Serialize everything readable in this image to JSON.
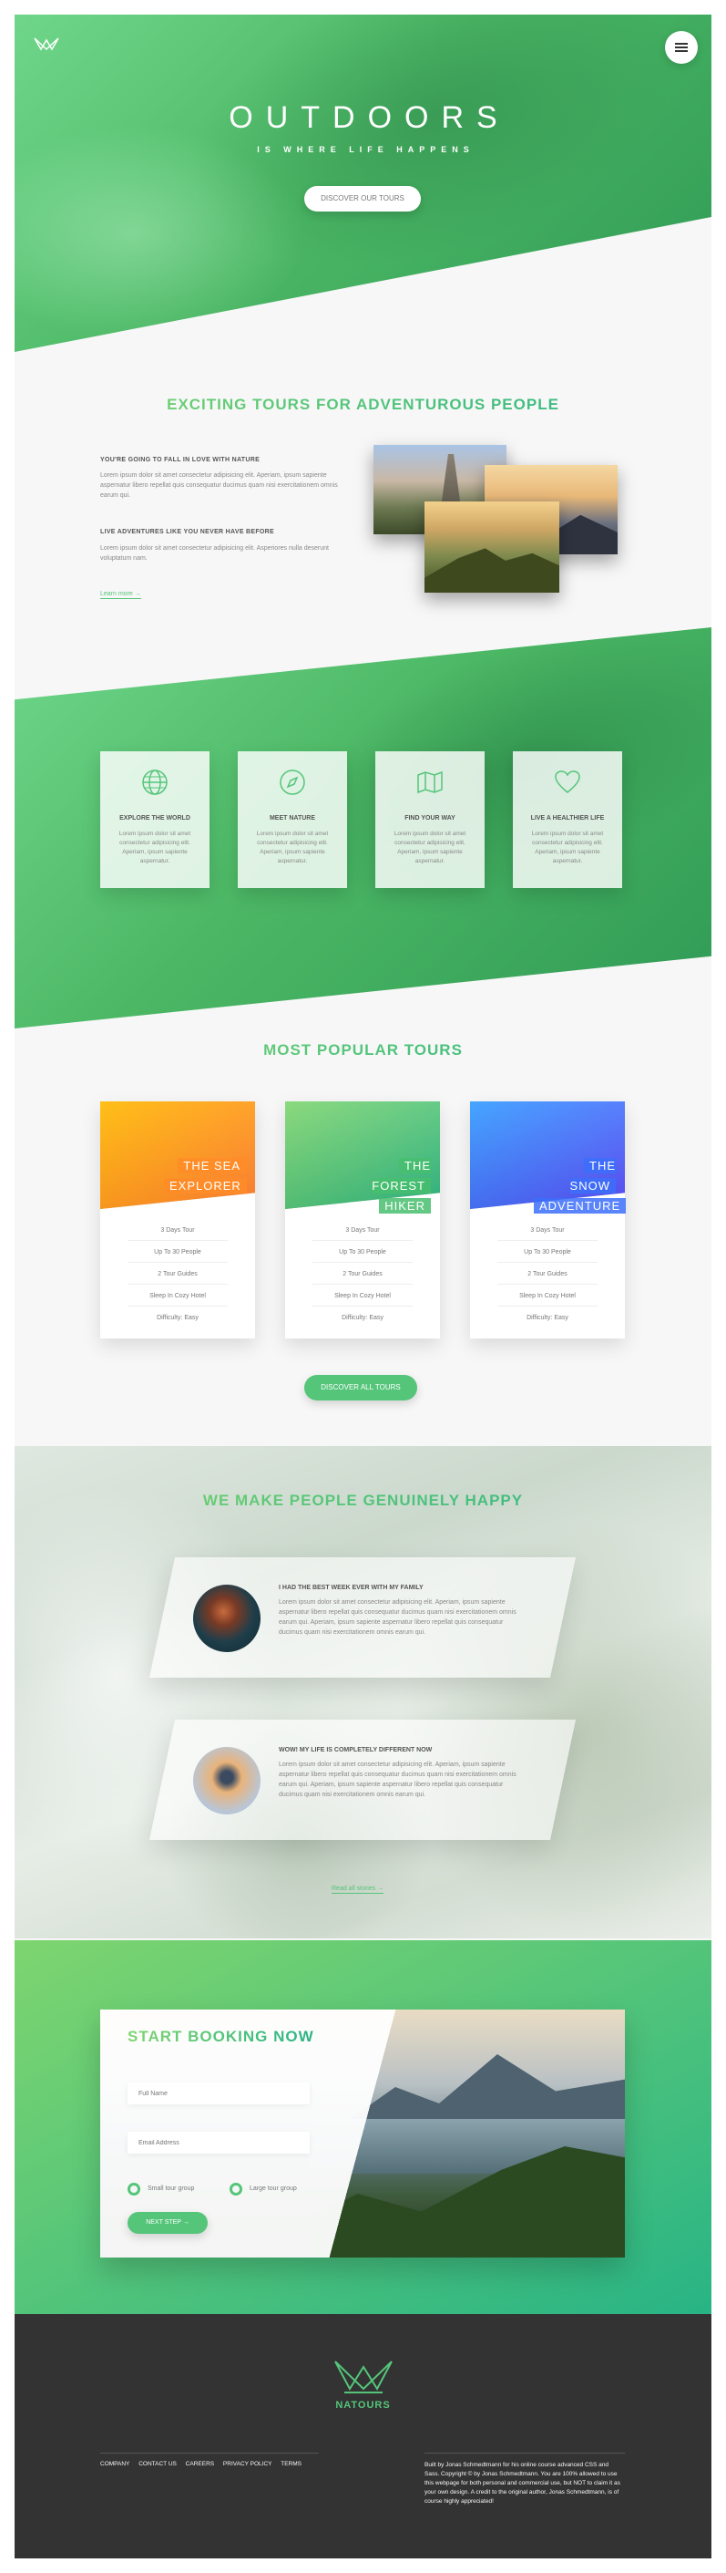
{
  "header": {
    "title": "OUTDOORS",
    "subtitle": "IS WHERE LIFE HAPPENS",
    "cta": "DISCOVER OUR TOURS",
    "logo_icon": "crown-logo-icon",
    "nav_icon": "hamburger-menu-icon"
  },
  "about": {
    "title": "EXCITING TOURS FOR ADVENTUROUS PEOPLE",
    "heading1": "YOU'RE GOING TO FALL IN LOVE WITH NATURE",
    "text1": "Lorem ipsum dolor sit amet consectetur adipisicing elit. Aperiam, ipsum sapiente aspernatur libero repellat quis consequatur ducimus quam nisi exercitationem omnis earum qui.",
    "heading2": "LIVE ADVENTURES LIKE YOU NEVER HAVE BEFORE",
    "text2": "Lorem ipsum dolor sit amet consectetur adipisicing elit. Asperiores nulla deserunt voluptatum nam.",
    "link": "Learn more →"
  },
  "features": [
    {
      "icon": "globe-icon",
      "title": "EXPLORE THE WORLD",
      "text": "Lorem ipsum dolor sit amet consectetur adipisicing elit. Aperiam, ipsum sapiente aspernatur."
    },
    {
      "icon": "compass-icon",
      "title": "MEET NATURE",
      "text": "Lorem ipsum dolor sit amet consectetur adipisicing elit. Aperiam, ipsum sapiente aspernatur."
    },
    {
      "icon": "map-icon",
      "title": "FIND YOUR WAY",
      "text": "Lorem ipsum dolor sit amet consectetur adipisicing elit. Aperiam, ipsum sapiente aspernatur."
    },
    {
      "icon": "heart-icon",
      "title": "LIVE A HEALTHIER LIFE",
      "text": "Lorem ipsum dolor sit amet consectetur adipisicing elit. Aperiam, ipsum sapiente aspernatur."
    }
  ],
  "tours": {
    "title": "MOST POPULAR TOURS",
    "items": [
      {
        "name1": "THE SEA",
        "name2": "EXPLORER",
        "color": "#ffb900",
        "details": [
          "3 Days Tour",
          "Up To 30 People",
          "2 Tour Guides",
          "Sleep In Cozy Hotel",
          "Difficulty: Easy"
        ]
      },
      {
        "name1": "THE FOREST",
        "name2": "HIKER",
        "color": "#7ed56f",
        "details": [
          "3 Days Tour",
          "Up To 30 People",
          "2 Tour Guides",
          "Sleep In Cozy Hotel",
          "Difficulty: Easy"
        ]
      },
      {
        "name1": "THE SNOW",
        "name2": "ADVENTURE",
        "color": "#2998ff",
        "details": [
          "3 Days Tour",
          "Up To 30 People",
          "2 Tour Guides",
          "Sleep In Cozy Hotel",
          "Difficulty: Easy"
        ]
      }
    ],
    "cta": "DISCOVER ALL TOURS"
  },
  "stories": {
    "title": "WE MAKE PEOPLE GENUINELY HAPPY",
    "items": [
      {
        "heading": "I HAD THE BEST WEEK EVER WITH MY FAMILY",
        "text": "Lorem ipsum dolor sit amet consectetur adipisicing elit. Aperiam, ipsum sapiente aspernatur libero repellat quis consequatur ducimus quam nisi exercitationem omnis earum qui. Aperiam, ipsum sapiente aspernatur libero repellat quis consequatur ducimus quam nisi exercitationem omnis earum qui."
      },
      {
        "heading": "WOW! MY LIFE IS COMPLETELY DIFFERENT NOW",
        "text": "Lorem ipsum dolor sit amet consectetur adipisicing elit. Aperiam, ipsum sapiente aspernatur libero repellat quis consequatur ducimus quam nisi exercitationem omnis earum qui. Aperiam, ipsum sapiente aspernatur libero repellat quis consequatur ducimus quam nisi exercitationem omnis earum qui."
      }
    ],
    "link": "Read all stories →"
  },
  "booking": {
    "title": "START BOOKING NOW",
    "name_placeholder": "Full Name",
    "email_placeholder": "Email Address",
    "option_small": "Small tour group",
    "option_large": "Large tour group",
    "cta": "NEXT STEP →"
  },
  "footer": {
    "brand": "NATOURS",
    "links": [
      "COMPANY",
      "CONTACT US",
      "CAREERS",
      "PRIVACY POLICY",
      "TERMS"
    ],
    "copyright": "Built by Jonas Schmedtmann for his online course advanced CSS and Sass. Copyright © by Jonas Schmedtmann. You are 100% allowed to use this webpage for both personal and commercial use, but NOT to claim it as your own design. A credit to the original author, Jonas Schmedtmann, is of course highly appreciated!"
  },
  "colors": {
    "primary": "#55c57a",
    "primary_light": "#7ed56f",
    "primary_dark": "#28b485",
    "footer_bg": "#333333"
  }
}
